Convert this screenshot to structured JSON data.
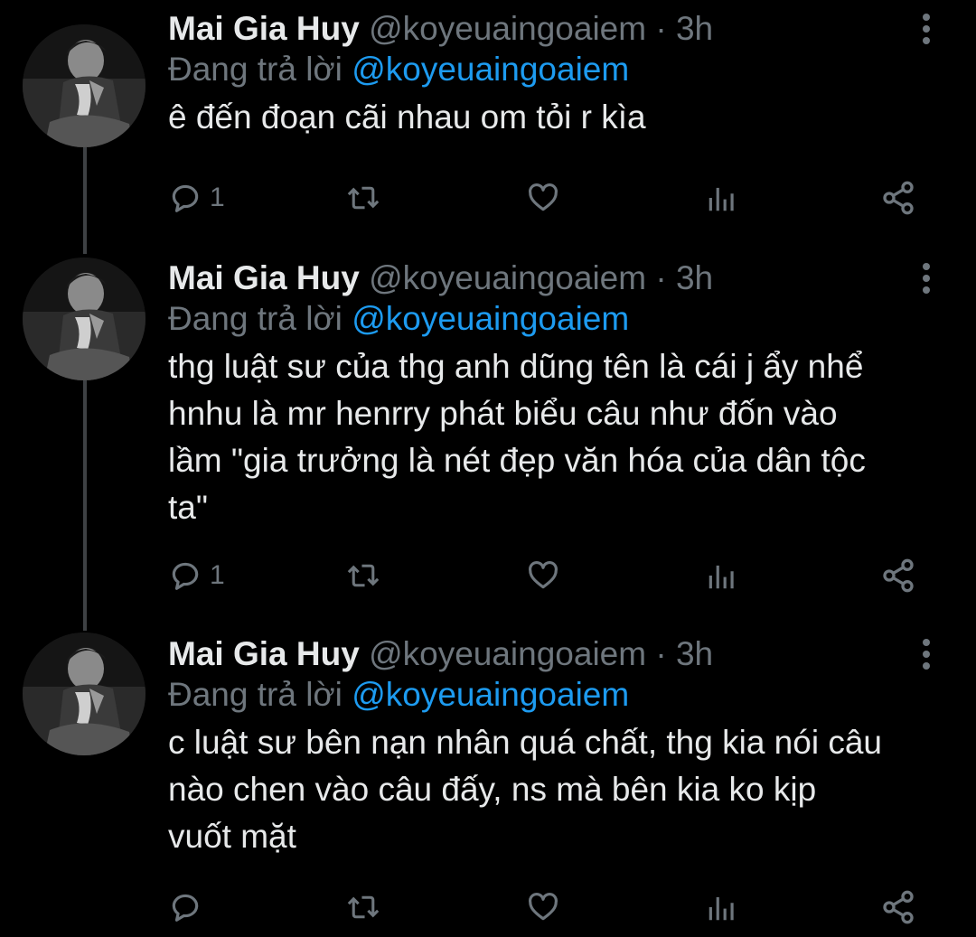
{
  "colors": {
    "background": "#000000",
    "text_primary": "#e7e9ea",
    "text_secondary": "#6e767d",
    "accent": "#1d9bf0",
    "thread_line": "#3e4144"
  },
  "tweets": [
    {
      "author": {
        "name": "Mai Gia Huy",
        "handle": "@koyeuaingoaiem"
      },
      "separator": "·",
      "time": "3h",
      "reply_prefix": "Đang trả lời",
      "reply_to": "@koyeuaingoaiem",
      "text": "ê đến đoạn cãi nhau om tỏi r kìa",
      "replies": "1",
      "retweets": "",
      "likes": "",
      "icons": [
        "reply-icon",
        "retweet-icon",
        "like-icon",
        "analytics-icon",
        "share-icon",
        "more-icon"
      ]
    },
    {
      "author": {
        "name": "Mai Gia Huy",
        "handle": "@koyeuaingoaiem"
      },
      "separator": "·",
      "time": "3h",
      "reply_prefix": "Đang trả lời",
      "reply_to": "@koyeuaingoaiem",
      "text": "thg luật sư của thg anh dũng tên là cái j ẩy nhể\nhnhu là mr henrry phát biểu câu như đốn vào\nlầm \"gia trưởng là nét đẹp văn hóa của dân tộc\nta\"",
      "replies": "1",
      "retweets": "",
      "likes": "",
      "icons": [
        "reply-icon",
        "retweet-icon",
        "like-icon",
        "analytics-icon",
        "share-icon",
        "more-icon"
      ]
    },
    {
      "author": {
        "name": "Mai Gia Huy",
        "handle": "@koyeuaingoaiem"
      },
      "separator": "·",
      "time": "3h",
      "reply_prefix": "Đang trả lời",
      "reply_to": "@koyeuaingoaiem",
      "text": "c luật sư bên nạn nhân quá chất, thg kia nói câu\nnào chen vào câu đấy, ns mà bên kia ko kịp\nvuốt mặt",
      "replies": "",
      "retweets": "",
      "likes": "",
      "icons": [
        "reply-icon",
        "retweet-icon",
        "like-icon",
        "analytics-icon",
        "share-icon",
        "more-icon"
      ]
    }
  ]
}
